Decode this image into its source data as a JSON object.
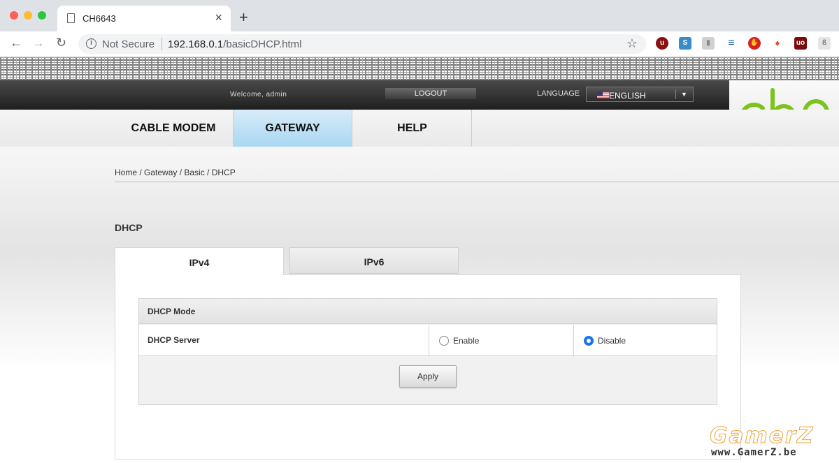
{
  "browser": {
    "tab_title": "CH6643",
    "tab_close": "×",
    "new_tab": "+",
    "security_label": "Not Secure",
    "url_host": "192.168.0.1",
    "url_path": "/basicDHCP.html",
    "star": "☆",
    "nav": {
      "back": "←",
      "forward": "→",
      "reload": "↻"
    },
    "extensions": [
      {
        "name": "ublock",
        "glyph": "u",
        "color": "#8b1010"
      },
      {
        "name": "s-extension",
        "glyph": "S",
        "color": "#3b8bc8"
      },
      {
        "name": "bookmark-extension",
        "glyph": "▮",
        "color": "#c8c8c8"
      },
      {
        "name": "stack-extension",
        "glyph": "≡",
        "color": "#1a56a8"
      },
      {
        "name": "stop-extension",
        "glyph": "✋",
        "color": "#d8211f"
      },
      {
        "name": "flame-extension",
        "glyph": "♦",
        "color": "#ffffff"
      },
      {
        "name": "ublock-origin",
        "glyph": "uo",
        "color": "#7d0a0a"
      },
      {
        "name": "ghost-extension",
        "glyph": "ß",
        "color": "#bdbdbd"
      }
    ]
  },
  "router": {
    "welcome": "Welcome, admin",
    "logout": "LOGOUT",
    "language_label": "LANGUAGE",
    "language_value": "ENGLISH",
    "logo_text": "cbn",
    "nav": [
      "CABLE MODEM",
      "GATEWAY",
      "HELP"
    ],
    "active_nav": "GATEWAY"
  },
  "breadcrumb": "Home / Gateway / Basic / DHCP",
  "page_title": "DHCP",
  "tabs": [
    "IPv4",
    "IPv6"
  ],
  "dhcp": {
    "mode_header": "DHCP Mode",
    "server_label": "DHCP Server",
    "enable_label": "Enable",
    "disable_label": "Disable",
    "selected": "Disable",
    "apply": "Apply"
  },
  "watermark": {
    "title": "GamerZ",
    "url": "www.GamerZ.be"
  },
  "colors": {
    "accent_green": "#7dc21e",
    "active_tab_blue": "#a9d7f1",
    "radio_blue": "#1a73e8"
  }
}
